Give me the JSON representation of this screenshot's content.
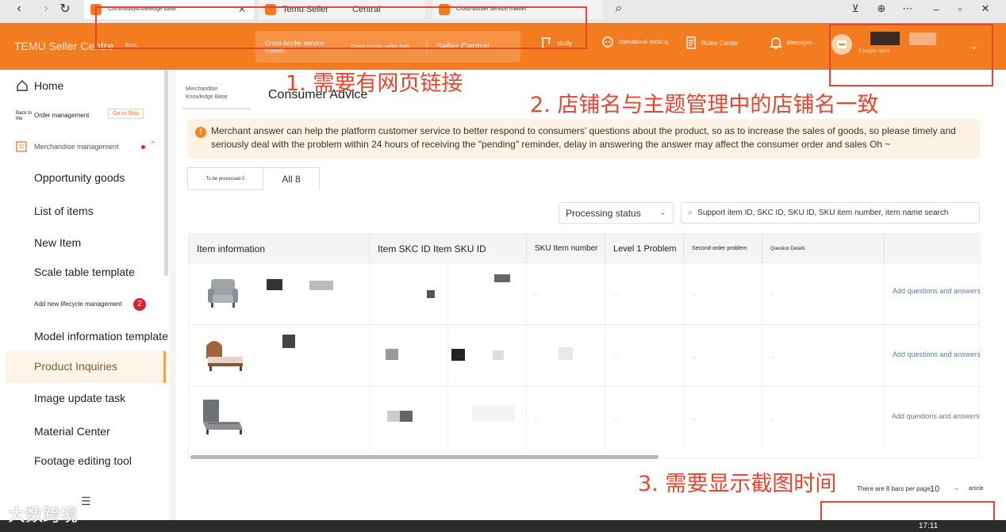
{
  "browser": {
    "tabs": [
      {
        "title": "Commodityknowledge base"
      },
      {
        "title": "Temu Seller"
      },
      {
        "title": "Central"
      },
      {
        "title": "Cross-border service market"
      }
    ]
  },
  "header": {
    "brand": "TEMU Seller Centre",
    "beta": "Beta",
    "switcher": {
      "item1": "Cross-border service market",
      "item2": "Cross-border seller hub",
      "item3": "Seller Central"
    },
    "nav": {
      "study": "study",
      "docking": "Operational docking",
      "rules": "Rules Center",
      "messages": "Messages"
    },
    "store_sub": "3 people home"
  },
  "sidebar": {
    "home": "Home",
    "back": "Back to the",
    "order_management": "Order management",
    "go_to_ship": "Go to Ship",
    "merchandise_management": "Merchandise management",
    "items": [
      {
        "label": "Opportunity goods"
      },
      {
        "label": "List of items"
      },
      {
        "label": "New Item"
      },
      {
        "label": "Scale table template"
      },
      {
        "label": "Add new lifecycle management"
      },
      {
        "label": "Model information template"
      },
      {
        "label": "Product Inquiries"
      },
      {
        "label": "Image update task"
      },
      {
        "label": "Material Center"
      },
      {
        "label": "Footage editing tool"
      }
    ],
    "lifecycle_badge": "2"
  },
  "main": {
    "breadcrumb": "Merchandise Knowledge Base",
    "title": "Consumer Advice",
    "notice": "Merchant answer can help the platform customer service to better respond to consumers' questions about the product, so as to increase the sales of goods, so please timely and seriously deal with the problem within 24 hours of receiving the \"pending\" reminder, delay in answering the answer may affect the consumer order and sales Oh ~",
    "tabs": {
      "pending": "To be processed 0",
      "all": "All 8"
    },
    "status_placeholder": "Processing status",
    "search_placeholder": "Support item ID, SKC ID, SKU ID, SKU item number, item name search"
  },
  "table": {
    "headers": {
      "info": "Item information",
      "skc_sku": "Item SKC ID Item SKU ID",
      "sku_number": "SKU Item number",
      "level1": "Level 1 Problem",
      "second": "Second-order problem",
      "details": "Question Details"
    },
    "rows": [
      {
        "action": "Add questions and answers",
        "dash": "-"
      },
      {
        "action": "Add questions and answers",
        "dash": "-"
      },
      {
        "action": "Add questions and answers",
        "dash": "-"
      }
    ]
  },
  "pagination": {
    "summary": "There are 8 bars per page",
    "page_size": "10",
    "unit": "article"
  },
  "annotations": {
    "a1": "1. 需要有网页链接",
    "a2": "2. 店铺名与主题管理中的店铺名一致",
    "a3": "3. 需要显示截图时间"
  },
  "overlay": {
    "watermark": "大数跨境",
    "clock": "17:11"
  },
  "colors": {
    "brand_orange": "#f47c20",
    "annotation_red": "#e6452f",
    "notice_bg": "#fdf2e3"
  }
}
